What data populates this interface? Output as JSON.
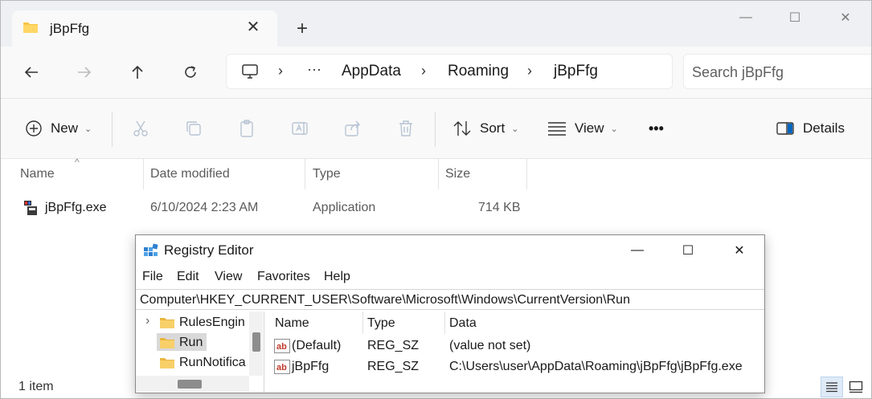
{
  "explorer": {
    "tab_title": "jBpFfg",
    "tab_close_glyph": "✕",
    "new_tab_glyph": "+",
    "window_controls": {
      "minimize": "—",
      "maximize": "☐",
      "close": "✕"
    },
    "nav": {
      "back": "←",
      "forward": "→",
      "up": "↑",
      "refresh": "↻"
    },
    "breadcrumb": [
      "AppData",
      "Roaming",
      "jBpFfg"
    ],
    "breadcrumb_ellipsis": "···",
    "breadcrumb_sep": "›",
    "search_placeholder": "Search jBpFfg",
    "commands": {
      "new": "New",
      "sort": "Sort",
      "view": "View",
      "more": "•••",
      "details": "Details"
    },
    "columns": [
      "Name",
      "Date modified",
      "Type",
      "Size"
    ],
    "sort_indicator": "^",
    "files": [
      {
        "name": "jBpFfg.exe",
        "date": "6/10/2024 2:23 AM",
        "type": "Application",
        "size": "714 KB"
      }
    ],
    "status": "1 item"
  },
  "regedit": {
    "title": "Registry Editor",
    "window_controls": {
      "minimize": "—",
      "maximize": "☐",
      "close": "✕"
    },
    "menu": [
      "File",
      "Edit",
      "View",
      "Favorites",
      "Help"
    ],
    "address": "Computer\\HKEY_CURRENT_USER\\Software\\Microsoft\\Windows\\CurrentVersion\\Run",
    "tree": [
      {
        "label": "RulesEngin",
        "expander": "›"
      },
      {
        "label": "Run",
        "selected": true
      },
      {
        "label": "RunNotifica"
      }
    ],
    "value_columns": [
      "Name",
      "Type",
      "Data"
    ],
    "values": [
      {
        "name": "(Default)",
        "type": "REG_SZ",
        "data": "(value not set)"
      },
      {
        "name": "jBpFfg",
        "type": "REG_SZ",
        "data": "C:\\Users\\user\\AppData\\Roaming\\jBpFfg\\jBpFfg.exe"
      }
    ]
  },
  "colors": {
    "accent": "#0067c0",
    "folder_yellow": "#f8c542",
    "disabled_icon": "#b8c4d4"
  }
}
